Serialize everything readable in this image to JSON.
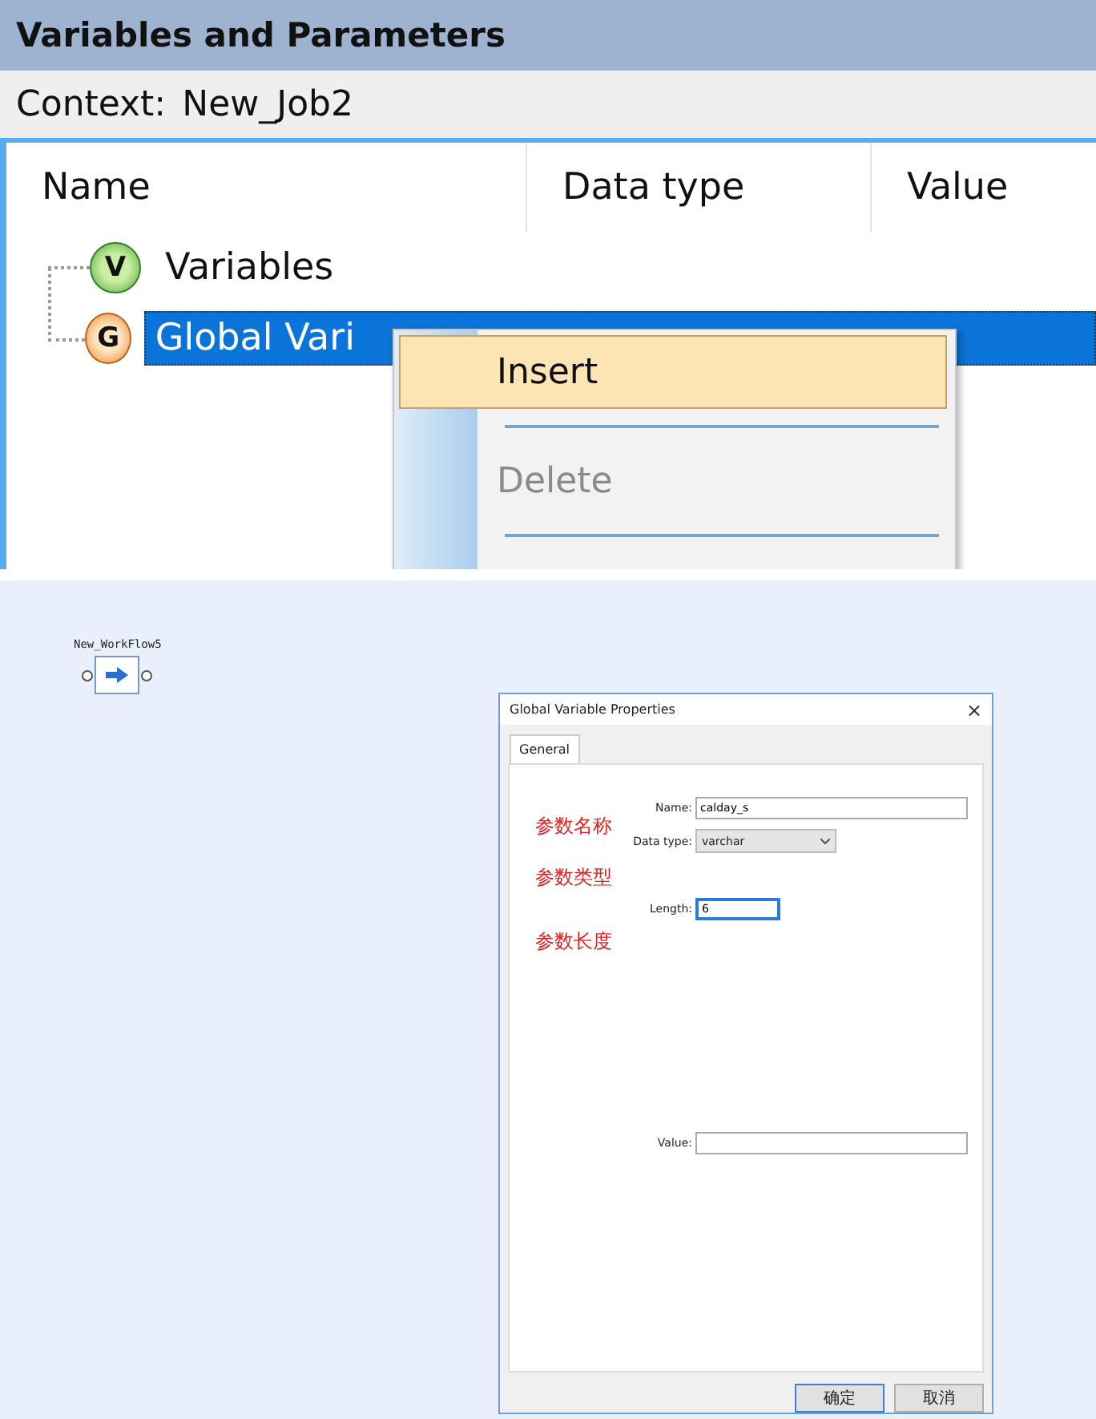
{
  "panel": {
    "title": "Variables and Parameters",
    "context_label": "Context:",
    "context_value": "New_Job2",
    "columns": [
      "Name",
      "Data type",
      "Value"
    ],
    "tree": [
      {
        "label": "Variables",
        "icon": "V",
        "selected": false
      },
      {
        "label": "Global Vari",
        "icon": "G",
        "selected": true
      }
    ]
  },
  "context_menu": {
    "items": [
      {
        "label": "Insert",
        "selected": true,
        "disabled": false
      },
      {
        "label": "Delete",
        "selected": false,
        "disabled": true
      }
    ]
  },
  "workflow": {
    "label": "New_WorkFlow5"
  },
  "dialog": {
    "title": "Global Variable Properties",
    "close": "×",
    "tabs": [
      {
        "label": "General",
        "selected": true
      }
    ],
    "fields": [
      {
        "kind": "text",
        "label": "Name:",
        "value": "calday_s",
        "focused": false
      },
      {
        "kind": "select",
        "label": "Data type:",
        "value": "varchar",
        "focused": false
      },
      {
        "kind": "text",
        "label": "Length:",
        "value": "6",
        "focused": true
      },
      {
        "kind": "text",
        "label": "Value:",
        "focused": false
      }
    ],
    "annotations": [
      "参数名称",
      "参数类型",
      "参数长度"
    ],
    "buttons": [
      {
        "label": "确定",
        "default": true
      },
      {
        "label": "取消",
        "default": false
      }
    ]
  }
}
